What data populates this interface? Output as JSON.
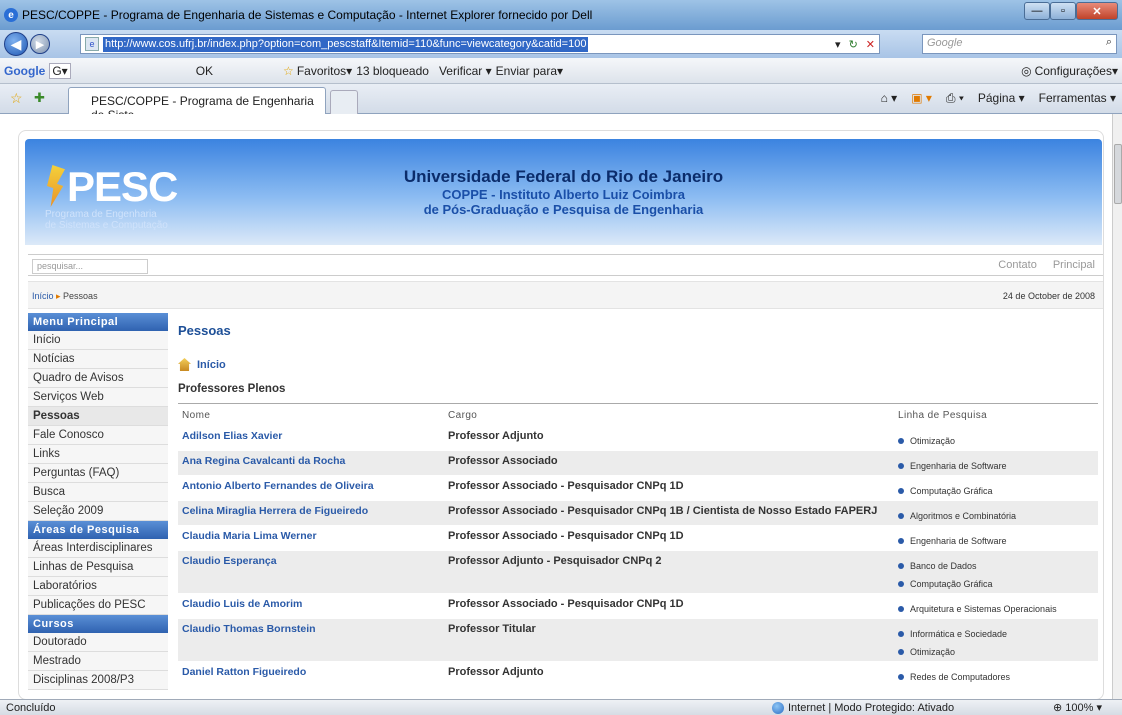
{
  "window": {
    "title": "PESC/COPPE - Programa de Engenharia de Sistemas e Computação - Internet Explorer fornecido por Dell"
  },
  "address": {
    "url": "http://www.cos.ufrj.br/index.php?option=com_pescstaff&Itemid=110&func=viewcategory&catid=100",
    "search_placeholder": "Google"
  },
  "googlebar": {
    "logo": "Google",
    "g": "G▾",
    "ok": "OK",
    "favoritos": "Favoritos▾",
    "bloqueado": "13 bloqueado",
    "verificar": "Verificar ▾",
    "enviar": "Enviar para▾",
    "config": "Configurações▾"
  },
  "tab": {
    "label": "PESC/COPPE - Programa de Engenharia de Siste..."
  },
  "cmd": {
    "pagina": "Página ▾",
    "ferramentas": "Ferramentas ▾"
  },
  "banner": {
    "logo": "PESC",
    "logo_sub1": "Programa de Engenharia",
    "logo_sub2": "de Sistemas e Computação",
    "line1": "Universidade Federal do Rio de Janeiro",
    "line2": "COPPE - Instituto Alberto Luiz Coimbra",
    "line3": "de Pós-Graduação e Pesquisa de Engenharia"
  },
  "site": {
    "search_placeholder": "pesquisar...",
    "contato": "Contato",
    "principal": "Principal",
    "crumb_home": "Início",
    "crumb_sep": " ▸ ",
    "crumb_current": "Pessoas",
    "date": "24 de October de 2008"
  },
  "menu": {
    "h1": "Menu Principal",
    "items1": [
      "Início",
      "Notícias",
      "Quadro de Avisos",
      "Serviços Web",
      "Pessoas",
      "Fale Conosco",
      "Links",
      "Perguntas (FAQ)",
      "Busca",
      "Seleção 2009"
    ],
    "h2": "Áreas de Pesquisa",
    "items2": [
      "Áreas Interdisciplinares",
      "Linhas de Pesquisa",
      "Laboratórios",
      "Publicações do PESC"
    ],
    "h3": "Cursos",
    "items3": [
      "Doutorado",
      "Mestrado",
      "Disciplinas 2008/P3"
    ]
  },
  "main": {
    "title": "Pessoas",
    "home": "Início",
    "subhead": "Professores Plenos",
    "cols": [
      "Nome",
      "Cargo",
      "Linha de Pesquisa"
    ],
    "rows": [
      {
        "nome": "Adilson Elias Xavier",
        "cargo": "Professor Adjunto",
        "linhas": [
          "Otimização"
        ]
      },
      {
        "nome": "Ana Regina Cavalcanti da Rocha",
        "cargo": "Professor Associado",
        "linhas": [
          "Engenharia de Software"
        ]
      },
      {
        "nome": "Antonio Alberto Fernandes de Oliveira",
        "cargo": "Professor Associado - Pesquisador CNPq 1D",
        "linhas": [
          "Computação Gráfica"
        ]
      },
      {
        "nome": "Celina Miraglia Herrera de Figueiredo",
        "cargo": "Professor Associado - Pesquisador CNPq 1B / Cientista de Nosso Estado FAPERJ",
        "linhas": [
          "Algoritmos e Combinatória"
        ]
      },
      {
        "nome": "Claudia Maria Lima Werner",
        "cargo": "Professor Associado - Pesquisador CNPq 1D",
        "linhas": [
          "Engenharia de Software"
        ]
      },
      {
        "nome": "Claudio Esperança",
        "cargo": "Professor Adjunto - Pesquisador CNPq 2",
        "linhas": [
          "Banco de Dados",
          "Computação Gráfica"
        ]
      },
      {
        "nome": "Claudio Luis de Amorim",
        "cargo": "Professor Associado - Pesquisador CNPq 1D",
        "linhas": [
          "Arquitetura e Sistemas Operacionais"
        ]
      },
      {
        "nome": "Claudio Thomas Bornstein",
        "cargo": "Professor Titular",
        "linhas": [
          "Informática e Sociedade",
          "Otimização"
        ]
      },
      {
        "nome": "Daniel Ratton Figueiredo",
        "cargo": "Professor Adjunto",
        "linhas": [
          "Redes de Computadores"
        ]
      }
    ]
  },
  "status": {
    "left": "Concluído",
    "zone": "Internet | Modo Protegido: Ativado",
    "zoom": "100%"
  }
}
